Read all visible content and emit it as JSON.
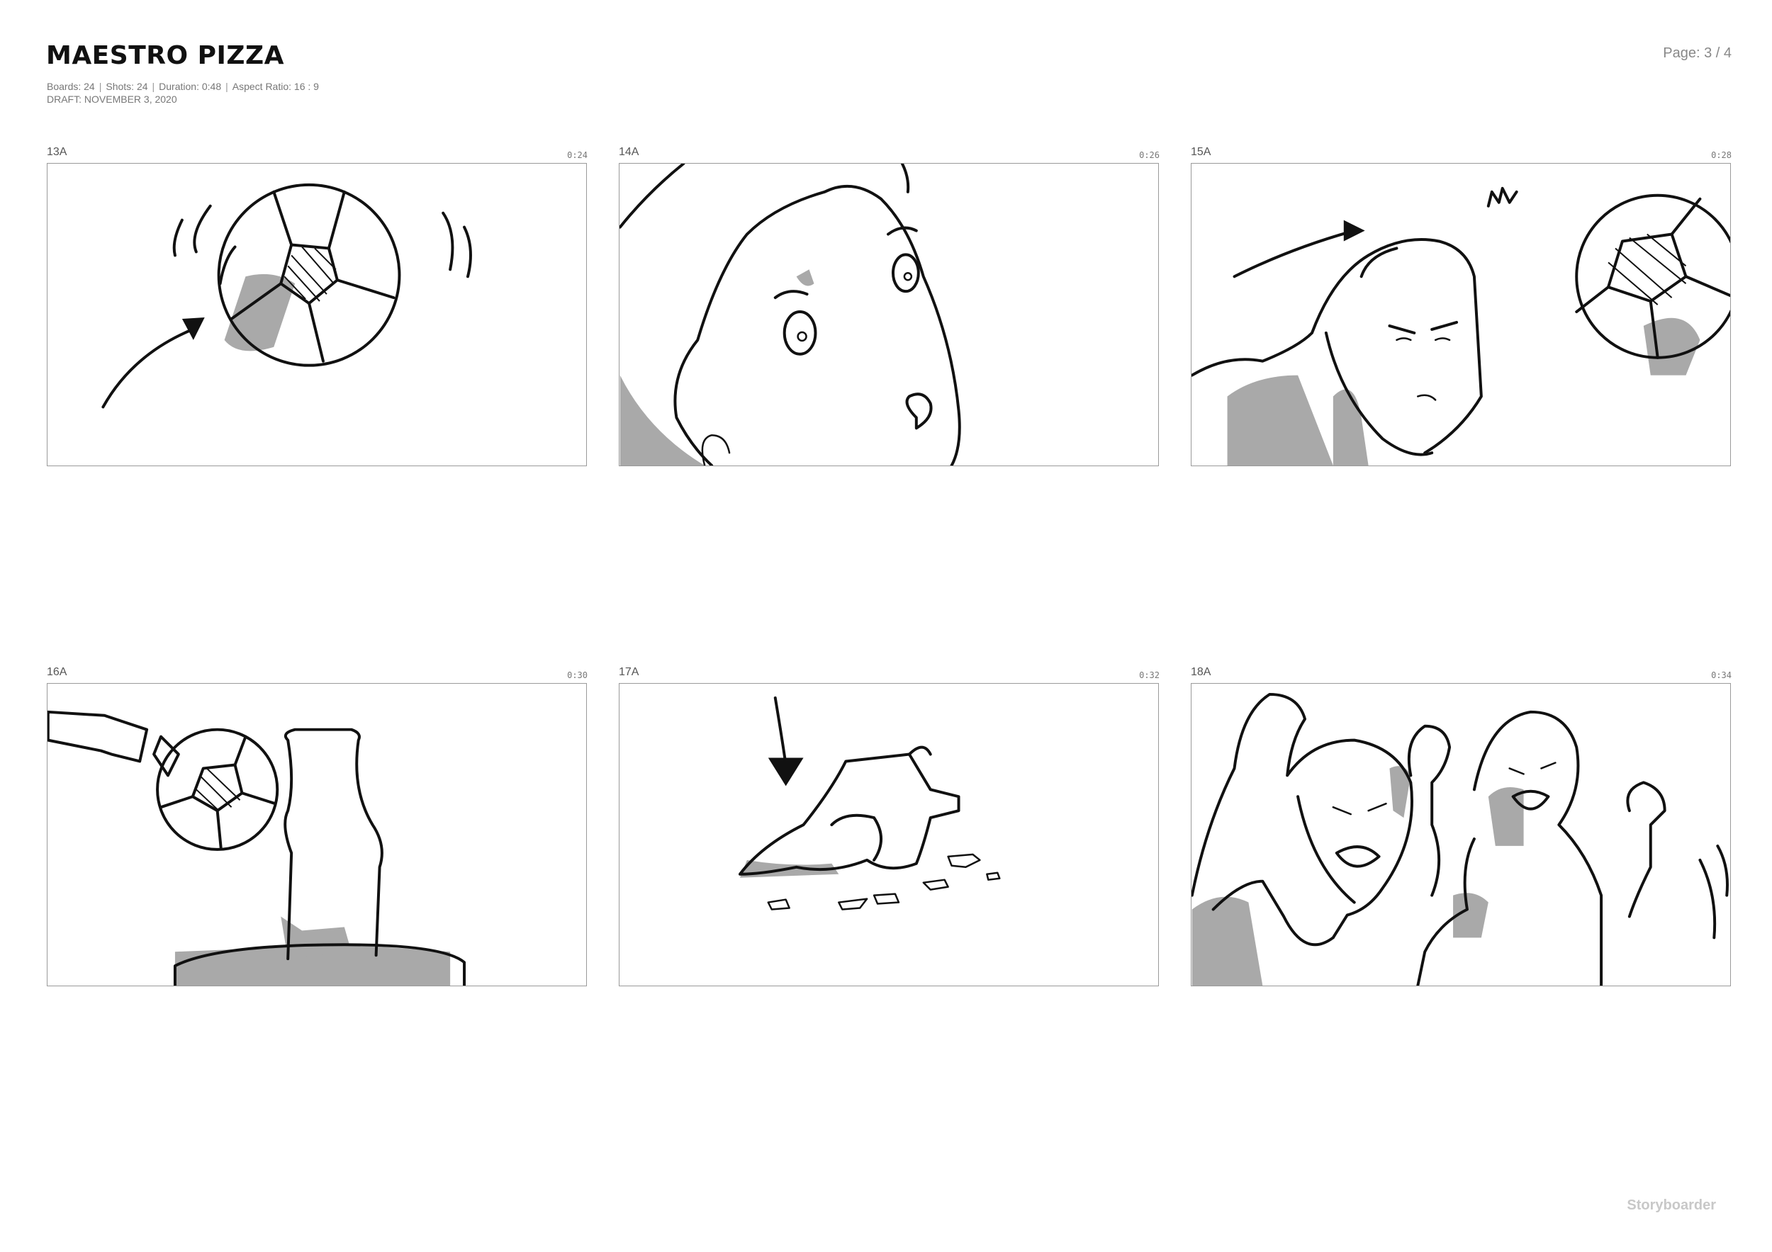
{
  "header": {
    "title": "MAESTRO PIZZA",
    "meta_line1": [
      "Boards: 24",
      "Shots: 24",
      "Duration: 0:48",
      "Aspect Ratio: 16 : 9"
    ],
    "meta_line2": "DRAFT: NOVEMBER 3, 2020",
    "page": "Page: 3 / 4"
  },
  "boards": [
    {
      "label": "13A",
      "time": "0:24",
      "icon": "soccer-ball-sketch"
    },
    {
      "label": "14A",
      "time": "0:26",
      "icon": "surprised-face-sketch"
    },
    {
      "label": "15A",
      "time": "0:28",
      "icon": "header-ball-sketch"
    },
    {
      "label": "16A",
      "time": "0:30",
      "icon": "ball-hits-vase-sketch"
    },
    {
      "label": "17A",
      "time": "0:32",
      "icon": "broken-vase-sketch"
    },
    {
      "label": "18A",
      "time": "0:34",
      "icon": "cheering-kids-sketch"
    }
  ],
  "footer": {
    "brand": "Storyboarder"
  }
}
